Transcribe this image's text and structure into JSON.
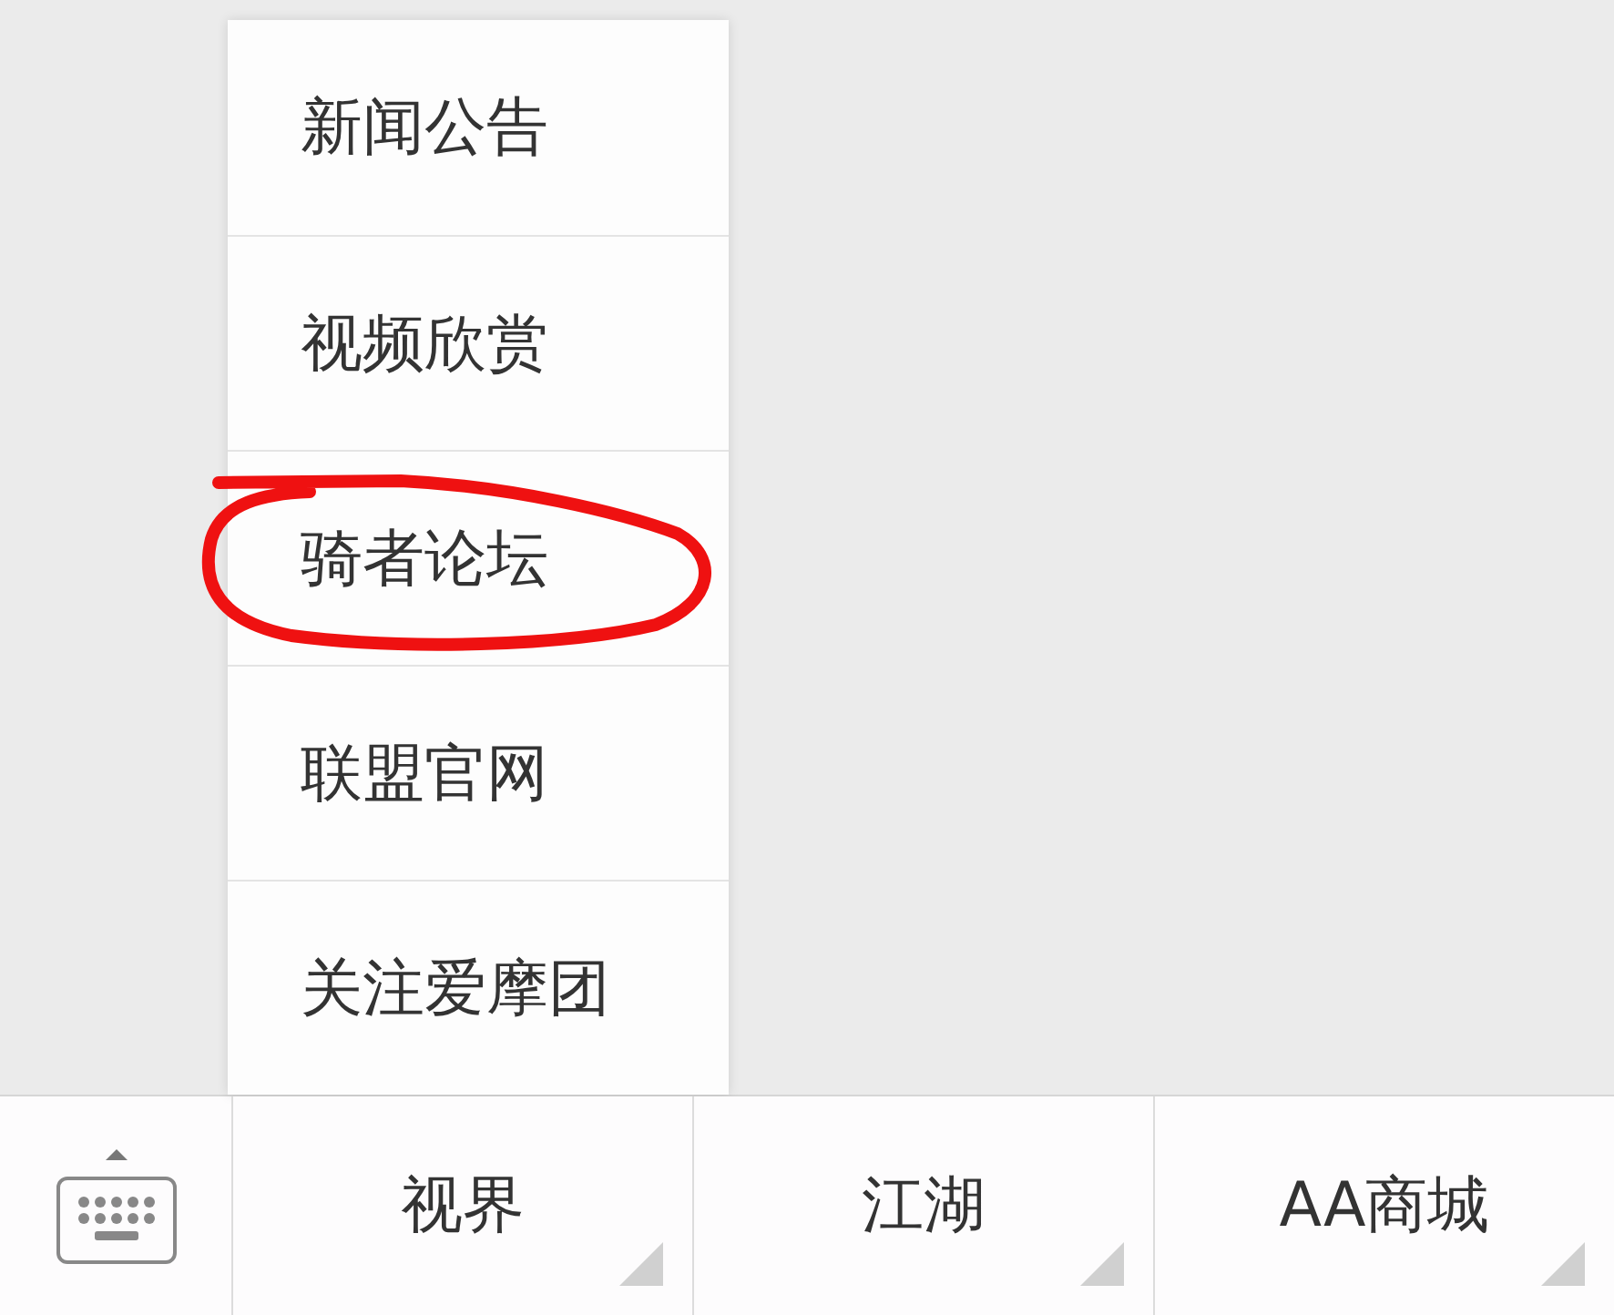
{
  "popup_menu": {
    "items": [
      {
        "label": "新闻公告",
        "annotated": false
      },
      {
        "label": "视频欣赏",
        "annotated": false
      },
      {
        "label": "骑者论坛",
        "annotated": true
      },
      {
        "label": "联盟官网",
        "annotated": false
      },
      {
        "label": "关注爱摩团",
        "annotated": false
      }
    ]
  },
  "bottom_menu": {
    "items": [
      {
        "label": "视界"
      },
      {
        "label": "江湖"
      },
      {
        "label": "AA商城"
      }
    ]
  }
}
